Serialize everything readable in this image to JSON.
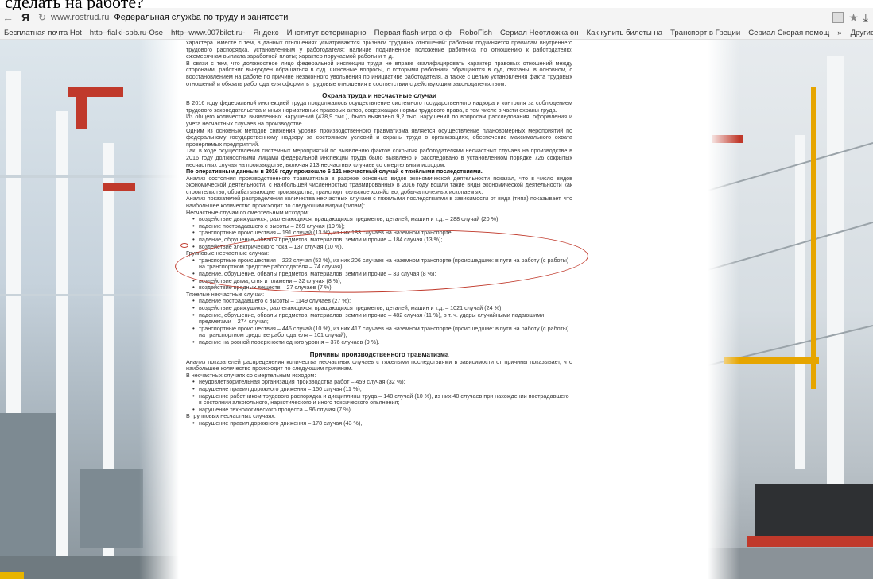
{
  "overlay_text": "сделать на работе?",
  "browser": {
    "url": "www.rostrud.ru",
    "page_title": "Федеральная служба по труду и занятости",
    "bookmarks": [
      "Бесплатная почта Hot",
      "http--fialki-spb.ru-Ose",
      "http--www.007bilet.ru-",
      "Яндекс",
      "Институт ветеринарно",
      "Первая flash-игра о ф",
      "RoboFish",
      "Сериал Неотложка он",
      "Как купить билеты на",
      "Транспорт в Греции",
      "Сериал Скорая помощ",
      "»",
      "Другие закладки"
    ]
  },
  "article": {
    "intro": [
      "характера. Вместе с тем, в данных отношениях усматриваются признаки трудовых отношений: работник подчиняется правилам внутреннего трудового распорядка, установленным у работодателя; наличие подчиненное положение работника по отношению к работодателю; ежемесячная выплата заработной платы; характер поручаемой работы и т. д.",
      "В связи с тем, что должностное лицо федеральной инспекции труда не вправе квалифицировать характер правовых отношений между сторонами, работник вынужден обращаться в суд. Основные вопросы, с которыми работники обращаются в суд, связаны, в основном, с восстановлением на работе по причине незаконного увольнения по инициативе работодателя, а также с целью установления факта трудовых отношений и обязать работодателя оформить трудовые отношения в соответствии с действующим законодательством."
    ],
    "section1_title": "Охрана труда и несчастные случаи",
    "section1_paragraphs": [
      "В 2016 году федеральной инспекцией труда продолжалось осуществление системного государственного надзора и контроля за соблюдением трудового законодательства и иных нормативных правовых актов, содержащих нормы трудового права, в том числе в части охраны труда.",
      "Из общего количества выявленных нарушений (478,9 тыс.), было выявлено 9,2 тыс. нарушений по вопросам расследования, оформления и учета несчастных случаев на производстве.",
      "Одним из основных методов снижения уровня производственного травматизма является осуществление плановомерных мероприятий по федеральному государственному надзору за состоянием условий и охраны труда в организациях, обеспечение максимального охвата проверяемых предприятий.",
      "Так, в ходе осуществления системных мероприятий по выявлению фактов сокрытия работодателями несчастных случаев на производстве в 2016 году должностными лицами федеральной инспекции труда было выявлено и расследовано в установленном порядке 726 сокрытых несчастных случая на производстве, включая 213 несчастных случаев со смертельным исходом."
    ],
    "highlight_sentence": "По оперативным данным в 2016 году произошло 6 121 несчастный случай с тяжёлыми последствиями.",
    "section1_after": [
      "Анализ состояния производственного травматизма в разрезе основных видов экономической деятельности показал, что в число видов экономической деятельности, с наибольшей численностью травмированных в 2016 году вошли такие виды экономической деятельности как строительство, обрабатывающие производства, транспорт, сельское хозяйство, добыча полезных ископаемых.",
      "Анализ показателей распределения количества несчастных случаев с тяжелыми последствиями в зависимости от вида (типа) показывает, что наибольшее количество происходит по следующим видам (типам):"
    ],
    "fatal_title": "Несчастные случаи со смертельным исходом:",
    "fatal_items": [
      "воздействие движущихся, разлетающихся, вращающихся предметов, деталей, машин и т.д. – 288 случай (20 %);",
      "падение пострадавшего с высоты – 269 случая (19 %);",
      "транспортные происшествия – 191 случай (13 %), из них 183 случаев на наземном транспорте;",
      "падение, обрушение, обвалы предметов, материалов, земли и прочие – 184 случая (13 %);",
      "воздействие электрического тока – 137 случая (10 %)."
    ],
    "group_title": "Групповые несчастные случаи:",
    "group_items": [
      "транспортные происшествия – 222 случая (53 %), из них 206 случаев на наземном транспорте (происшедшие: в пути на работу (с работы) на транспортном средстве работодателя – 74 случая);",
      "падение, обрушение, обвалы предметов, материалов, земли и прочие – 33 случая (8 %);",
      "воздействие дыма, огня и пламени – 32 случая (8 %);",
      "воздействие вредных веществ – 27 случаев (7 %)."
    ],
    "severe_title": "Тяжелые несчастные случаи:",
    "severe_items": [
      "падение пострадавшего с высоты – 1149 случаев (27 %);",
      "воздействие движущихся, разлетающихся, вращающихся предметов, деталей, машин и т.д. – 1021 случай (24 %);",
      "падение, обрушение, обвалы предметов, материалов, земли и прочие – 482 случая (11 %), в т. ч. удары случайными падающими предметами – 274 случая;",
      "транспортные происшествия – 446 случай (10 %), из них 417 случаев на наземном транспорте (происшедшие: в пути на работу (с работы) на транспортном средстве работодателя – 101 случай);",
      "падение на ровной поверхности одного уровня – 376 случаев (9 %)."
    ],
    "section2_title": "Причины производственного травматизма",
    "section2_intro": "Анализ показателей распределения количества несчастных случаев с тяжелыми последствиями в зависимости от причины показывает, что наибольшее количество происходит по следующим причинам.",
    "fatal2_title": "В несчастных случаях со смертельным исходом:",
    "fatal2_items": [
      "неудовлетворительная организация производства работ – 459 случая (32 %);",
      "нарушение правил дорожного движения – 150 случая (11 %);",
      "нарушение работником трудового распорядка и дисциплины труда – 148 случай (10 %), из них 40 случаев при нахождении пострадавшего в состоянии алкогольного, наркотического и иного токсического опьянения;",
      "нарушение технологического процесса – 96 случая (7 %)."
    ],
    "group2_title": "В групповых несчастных случаях:",
    "group2_items": [
      "нарушение правил дорожного движения – 178 случая (43 %),"
    ]
  }
}
